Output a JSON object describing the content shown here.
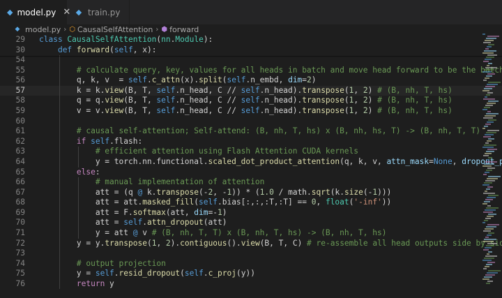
{
  "tabs": [
    {
      "label": "model.py",
      "active": true
    },
    {
      "label": "train.py",
      "active": false
    }
  ],
  "breadcrumb": [
    {
      "label": "model.py",
      "icon": "python-file-icon"
    },
    {
      "label": "CausalSelfAttention",
      "icon": "class-symbol-icon"
    },
    {
      "label": "forward",
      "icon": "method-symbol-icon"
    }
  ],
  "editor": {
    "current_line": "57",
    "lines": [
      {
        "n": "29",
        "indent": 0,
        "code": [
          [
            "kw",
            "class "
          ],
          [
            "cls",
            "CausalSelfAttention"
          ],
          [
            "op",
            "("
          ],
          [
            "cls",
            "nn"
          ],
          [
            "op",
            "."
          ],
          [
            "cls",
            "Module"
          ],
          [
            "op",
            "):"
          ]
        ]
      },
      {
        "n": "30",
        "indent": 1,
        "code": [
          [
            "kw",
            "def "
          ],
          [
            "fn",
            "forward"
          ],
          [
            "op",
            "("
          ],
          [
            "self",
            "self"
          ],
          [
            "op",
            ", x):"
          ]
        ]
      },
      {
        "n": "54",
        "indent": 2,
        "code": []
      },
      {
        "n": "55",
        "indent": 2,
        "code": [
          [
            "cm",
            "# calculate query, key, values for all heads in batch and move head forward to be the batch"
          ]
        ]
      },
      {
        "n": "56",
        "indent": 2,
        "code": [
          [
            "op",
            "q, k, v  = "
          ],
          [
            "self",
            "self"
          ],
          [
            "op",
            "."
          ],
          [
            "fn",
            "c_attn"
          ],
          [
            "op",
            "(x)."
          ],
          [
            "fn",
            "split"
          ],
          [
            "op",
            "("
          ],
          [
            "self",
            "self"
          ],
          [
            "op",
            ".n_embd, "
          ],
          [
            "param",
            "dim"
          ],
          [
            "op",
            "="
          ],
          [
            "num",
            "2"
          ],
          [
            "op",
            ")"
          ]
        ]
      },
      {
        "n": "57",
        "indent": 2,
        "code": [
          [
            "op",
            "k = k."
          ],
          [
            "fn",
            "view"
          ],
          [
            "op",
            "(B, T, "
          ],
          [
            "self",
            "self"
          ],
          [
            "op",
            ".n_head, C // "
          ],
          [
            "self",
            "self"
          ],
          [
            "op",
            ".n_head)."
          ],
          [
            "fn",
            "transpose"
          ],
          [
            "op",
            "("
          ],
          [
            "num",
            "1"
          ],
          [
            "op",
            ", "
          ],
          [
            "num",
            "2"
          ],
          [
            "op",
            ") "
          ],
          [
            "cm",
            "# (B, nh, T, hs)"
          ]
        ]
      },
      {
        "n": "58",
        "indent": 2,
        "code": [
          [
            "op",
            "q = q."
          ],
          [
            "fn",
            "view"
          ],
          [
            "op",
            "(B, T, "
          ],
          [
            "self",
            "self"
          ],
          [
            "op",
            ".n_head, C // "
          ],
          [
            "self",
            "self"
          ],
          [
            "op",
            ".n_head)."
          ],
          [
            "fn",
            "transpose"
          ],
          [
            "op",
            "("
          ],
          [
            "num",
            "1"
          ],
          [
            "op",
            ", "
          ],
          [
            "num",
            "2"
          ],
          [
            "op",
            ") "
          ],
          [
            "cm",
            "# (B, nh, T, hs)"
          ]
        ]
      },
      {
        "n": "59",
        "indent": 2,
        "code": [
          [
            "op",
            "v = v."
          ],
          [
            "fn",
            "view"
          ],
          [
            "op",
            "(B, T, "
          ],
          [
            "self",
            "self"
          ],
          [
            "op",
            ".n_head, C // "
          ],
          [
            "self",
            "self"
          ],
          [
            "op",
            ".n_head)."
          ],
          [
            "fn",
            "transpose"
          ],
          [
            "op",
            "("
          ],
          [
            "num",
            "1"
          ],
          [
            "op",
            ", "
          ],
          [
            "num",
            "2"
          ],
          [
            "op",
            ") "
          ],
          [
            "cm",
            "# (B, nh, T, hs)"
          ]
        ]
      },
      {
        "n": "60",
        "indent": 2,
        "code": []
      },
      {
        "n": "61",
        "indent": 2,
        "code": [
          [
            "cm",
            "# causal self-attention; Self-attend: (B, nh, T, hs) x (B, nh, hs, T) -> (B, nh, T, T)"
          ]
        ]
      },
      {
        "n": "62",
        "indent": 2,
        "code": [
          [
            "ctl",
            "if "
          ],
          [
            "self",
            "self"
          ],
          [
            "op",
            ".flash:"
          ]
        ]
      },
      {
        "n": "63",
        "indent": 3,
        "code": [
          [
            "cm",
            "# efficient attention using Flash Attention CUDA kernels"
          ]
        ]
      },
      {
        "n": "64",
        "indent": 3,
        "code": [
          [
            "op",
            "y = torch.nn.functional."
          ],
          [
            "fn",
            "scaled_dot_product_attention"
          ],
          [
            "op",
            "(q, k, v, "
          ],
          [
            "param",
            "attn_mask"
          ],
          [
            "op",
            "="
          ],
          [
            "kw",
            "None"
          ],
          [
            "op",
            ", "
          ],
          [
            "param",
            "dropout_p"
          ]
        ]
      },
      {
        "n": "65",
        "indent": 2,
        "code": [
          [
            "ctl",
            "else"
          ],
          [
            "op",
            ":"
          ]
        ]
      },
      {
        "n": "66",
        "indent": 3,
        "code": [
          [
            "cm",
            "# manual implementation of attention"
          ]
        ]
      },
      {
        "n": "67",
        "indent": 3,
        "code": [
          [
            "op",
            "att = (q "
          ],
          [
            "kw",
            "@"
          ],
          [
            "op",
            " k."
          ],
          [
            "fn",
            "transpose"
          ],
          [
            "op",
            "(-"
          ],
          [
            "num",
            "2"
          ],
          [
            "op",
            ", -"
          ],
          [
            "num",
            "1"
          ],
          [
            "op",
            ")) * ("
          ],
          [
            "num",
            "1.0"
          ],
          [
            "op",
            " / math."
          ],
          [
            "fn",
            "sqrt"
          ],
          [
            "op",
            "(k."
          ],
          [
            "fn",
            "size"
          ],
          [
            "op",
            "(-"
          ],
          [
            "num",
            "1"
          ],
          [
            "op",
            ")))"
          ]
        ]
      },
      {
        "n": "68",
        "indent": 3,
        "code": [
          [
            "op",
            "att = att."
          ],
          [
            "fn",
            "masked_fill"
          ],
          [
            "op",
            "("
          ],
          [
            "self",
            "self"
          ],
          [
            "op",
            ".bias[:,:,:T,:T] == "
          ],
          [
            "num",
            "0"
          ],
          [
            "op",
            ", "
          ],
          [
            "cls",
            "float"
          ],
          [
            "op",
            "("
          ],
          [
            "str",
            "'-inf'"
          ],
          [
            "op",
            "))"
          ]
        ]
      },
      {
        "n": "69",
        "indent": 3,
        "code": [
          [
            "op",
            "att = F."
          ],
          [
            "fn",
            "softmax"
          ],
          [
            "op",
            "(att, "
          ],
          [
            "param",
            "dim"
          ],
          [
            "op",
            "=-"
          ],
          [
            "num",
            "1"
          ],
          [
            "op",
            ")"
          ]
        ]
      },
      {
        "n": "70",
        "indent": 3,
        "code": [
          [
            "op",
            "att = "
          ],
          [
            "self",
            "self"
          ],
          [
            "op",
            "."
          ],
          [
            "fn",
            "attn_dropout"
          ],
          [
            "op",
            "(att)"
          ]
        ]
      },
      {
        "n": "71",
        "indent": 3,
        "code": [
          [
            "op",
            "y = att "
          ],
          [
            "kw",
            "@"
          ],
          [
            "op",
            " v "
          ],
          [
            "cm",
            "# (B, nh, T, T) x (B, nh, T, hs) -> (B, nh, T, hs)"
          ]
        ]
      },
      {
        "n": "72",
        "indent": 2,
        "code": [
          [
            "op",
            "y = y."
          ],
          [
            "fn",
            "transpose"
          ],
          [
            "op",
            "("
          ],
          [
            "num",
            "1"
          ],
          [
            "op",
            ", "
          ],
          [
            "num",
            "2"
          ],
          [
            "op",
            ")."
          ],
          [
            "fn",
            "contiguous"
          ],
          [
            "op",
            "()."
          ],
          [
            "fn",
            "view"
          ],
          [
            "op",
            "(B, T, C) "
          ],
          [
            "cm",
            "# re-assemble all head outputs side by side"
          ]
        ]
      },
      {
        "n": "73",
        "indent": 2,
        "code": []
      },
      {
        "n": "74",
        "indent": 2,
        "code": [
          [
            "cm",
            "# output projection"
          ]
        ]
      },
      {
        "n": "75",
        "indent": 2,
        "code": [
          [
            "op",
            "y = "
          ],
          [
            "self",
            "self"
          ],
          [
            "op",
            "."
          ],
          [
            "fn",
            "resid_dropout"
          ],
          [
            "op",
            "("
          ],
          [
            "self",
            "self"
          ],
          [
            "op",
            "."
          ],
          [
            "fn",
            "c_proj"
          ],
          [
            "op",
            "(y))"
          ]
        ]
      },
      {
        "n": "76",
        "indent": 2,
        "code": [
          [
            "ctl",
            "return"
          ],
          [
            "op",
            " y"
          ]
        ]
      }
    ]
  }
}
